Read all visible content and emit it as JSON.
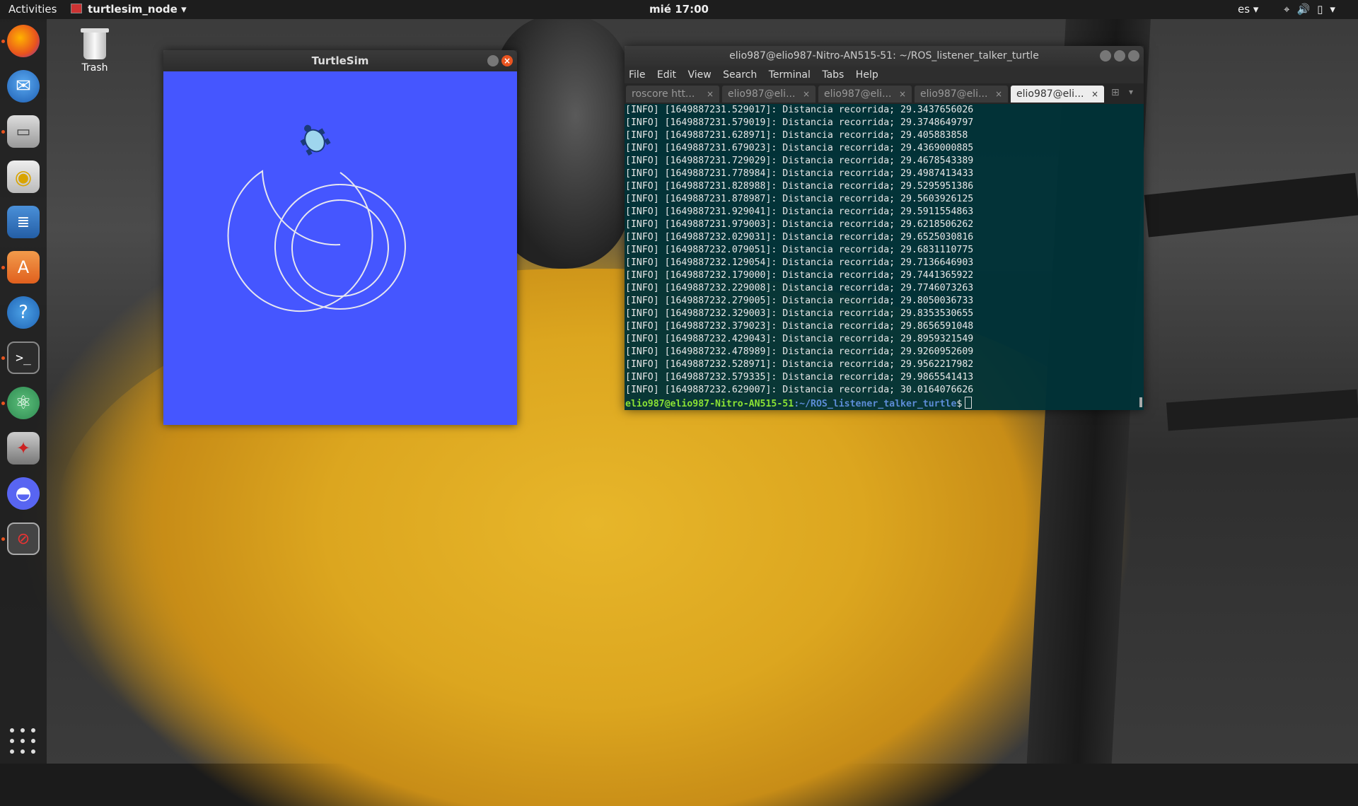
{
  "topbar": {
    "activities": "Activities",
    "app_name": "turtlesim_node",
    "clock": "mié 17:00",
    "lang": "es"
  },
  "dock": {
    "items": [
      "firefox",
      "thunderbird",
      "files",
      "rhythmbox",
      "libreoffice-writer",
      "software-center",
      "help",
      "terminal",
      "atom",
      "system-settings",
      "discord",
      "recording"
    ]
  },
  "desktop": {
    "trash_label": "Trash"
  },
  "turtlesim": {
    "title": "TurtleSim",
    "background": "#4556ff"
  },
  "terminal": {
    "title": "elio987@elio987-Nitro-AN515-51: ~/ROS_listener_talker_turtle",
    "menu": [
      "File",
      "Edit",
      "View",
      "Search",
      "Terminal",
      "Tabs",
      "Help"
    ],
    "tabs": [
      "roscore htt...",
      "elio987@eli...",
      "elio987@eli...",
      "elio987@eli...",
      "elio987@eli..."
    ],
    "lines": [
      "[INFO] [1649887231.529017]: Distancia recorrida; 29.3437656026",
      "[INFO] [1649887231.579019]: Distancia recorrida; 29.3748649797",
      "[INFO] [1649887231.628971]: Distancia recorrida; 29.405883858",
      "[INFO] [1649887231.679023]: Distancia recorrida; 29.4369000885",
      "[INFO] [1649887231.729029]: Distancia recorrida; 29.4678543389",
      "[INFO] [1649887231.778984]: Distancia recorrida; 29.4987413433",
      "[INFO] [1649887231.828988]: Distancia recorrida; 29.5295951386",
      "[INFO] [1649887231.878987]: Distancia recorrida; 29.5603926125",
      "[INFO] [1649887231.929041]: Distancia recorrida; 29.5911554863",
      "[INFO] [1649887231.979003]: Distancia recorrida; 29.6218506262",
      "[INFO] [1649887232.029031]: Distancia recorrida; 29.6525030816",
      "[INFO] [1649887232.079051]: Distancia recorrida; 29.6831110775",
      "[INFO] [1649887232.129054]: Distancia recorrida; 29.7136646903",
      "[INFO] [1649887232.179000]: Distancia recorrida; 29.7441365922",
      "[INFO] [1649887232.229008]: Distancia recorrida; 29.7746073263",
      "[INFO] [1649887232.279005]: Distancia recorrida; 29.8050036733",
      "[INFO] [1649887232.329003]: Distancia recorrida; 29.8353530655",
      "[INFO] [1649887232.379023]: Distancia recorrida; 29.8656591048",
      "[INFO] [1649887232.429043]: Distancia recorrida; 29.8959321549",
      "[INFO] [1649887232.478989]: Distancia recorrida; 29.9260952609",
      "[INFO] [1649887232.528971]: Distancia recorrida; 29.9562217982",
      "[INFO] [1649887232.579335]: Distancia recorrida; 29.9865541413",
      "[INFO] [1649887232.629007]: Distancia recorrida; 30.0164076626"
    ],
    "prompt_user": "elio987@elio987-Nitro-AN515-51",
    "prompt_path": ":~/ROS_listener_talker_turtle",
    "prompt_symbol": "$"
  }
}
